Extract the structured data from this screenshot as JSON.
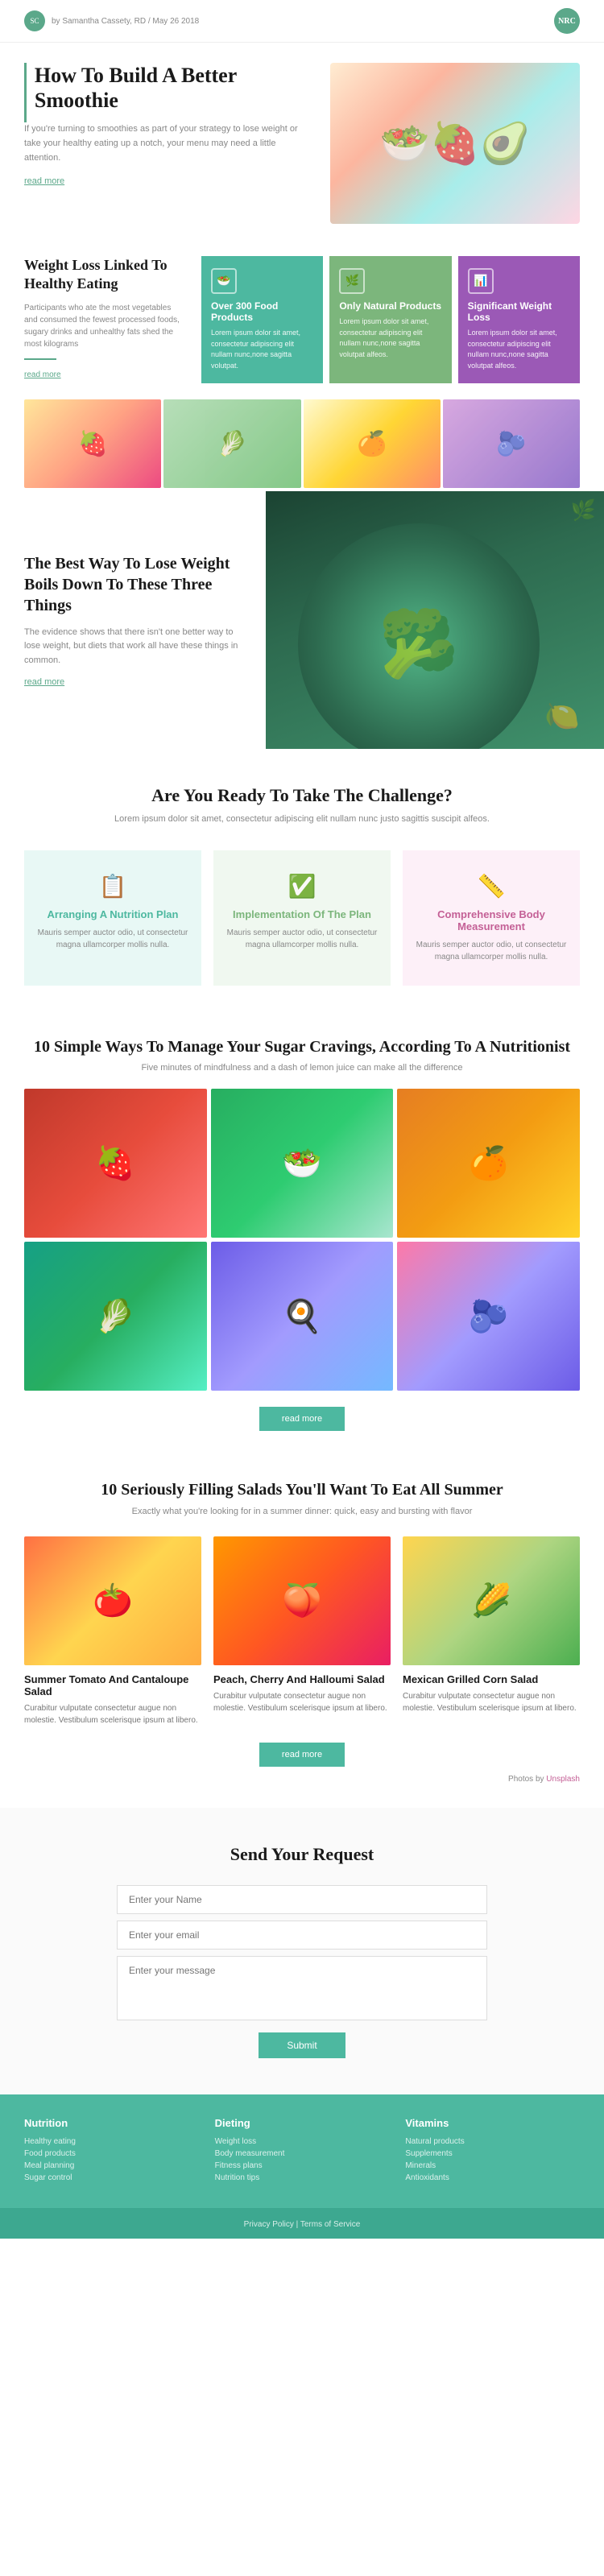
{
  "header": {
    "author": "by Samantha Cassety, RD / May 26 2018",
    "logo_text": "NRC"
  },
  "hero": {
    "title": "How To Build A Better Smoothie",
    "description": "If you're turning to smoothies as part of your strategy to lose weight or take your healthy eating up a notch, your menu may need a little attention.",
    "read_more": "read more"
  },
  "weight_section": {
    "title": "Weight Loss Linked To Healthy Eating",
    "description": "Participants who ate the most vegetables and consumed the fewest processed foods, sugary drinks and unhealthy fats shed the most kilograms",
    "read_more": "read more",
    "cards": [
      {
        "title": "Over 300 Food Products",
        "text": "Lorem ipsum dolor sit amet, consectetur adipiscing elit nullam nunc,none sagitta volutpat.",
        "bg": "teal",
        "icon": "🥗"
      },
      {
        "title": "Only Natural Products",
        "text": "Lorem ipsum dolor sit amet, consectetur adipiscing elit nullam nunc,none sagitta volutpat alfeos.",
        "bg": "green",
        "icon": "🌿"
      },
      {
        "title": "Significant Weight Loss",
        "text": "Lorem ipsum dolor sit amet, consectetur adipiscing elit nullam nunc,none sagitta volutpat alfeos.",
        "bg": "purple",
        "icon": "📊"
      }
    ]
  },
  "best_way": {
    "title": "The Best Way To Lose Weight Boils Down To These Three Things",
    "description": "The evidence shows that there isn't one better way to lose weight, but diets that work all have these things in common.",
    "read_more": "read more"
  },
  "challenge": {
    "title": "Are You Ready To Take The Challenge?",
    "subtitle": "Lorem ipsum dolor sit amet, consectetur adipiscing elit nullam nunc justo sagittis suscipit alfeos.",
    "cards": [
      {
        "title": "Arranging A Nutrition Plan",
        "text": "Mauris semper auctor odio, ut consectetur magna ullamcorper mollis nulla.",
        "bg": "teal",
        "icon": "📋"
      },
      {
        "title": "Implementation Of The Plan",
        "text": "Mauris semper auctor odio, ut consectetur magna ullamcorper mollis nulla.",
        "bg": "green",
        "icon": "✅"
      },
      {
        "title": "Comprehensive Body Measurement",
        "text": "Mauris semper auctor odio, ut consectetur magna ullamcorper mollis nulla.",
        "bg": "pink",
        "icon": "📏"
      }
    ]
  },
  "sugar": {
    "title": "10 Simple Ways To Manage Your Sugar Cravings, According To A Nutritionist",
    "subtitle": "Five minutes of mindfulness and a dash of lemon juice can make all the difference",
    "read_more": "read more"
  },
  "salads": {
    "title": "10 Seriously Filling Salads You'll Want To Eat All Summer",
    "subtitle": "Exactly what you're looking for in a summer dinner: quick, easy and bursting with flavor",
    "read_more": "read more",
    "photos_by": "Photos by",
    "photos_link": "Unsplash",
    "items": [
      {
        "name": "Summer Tomato And Cantaloupe Salad",
        "description": "Curabitur vulputate consectetur augue non molestie. Vestibulum scelerisque ipsum at libero."
      },
      {
        "name": "Peach, Cherry And Halloumi Salad",
        "description": "Curabitur vulputate consectetur augue non molestie. Vestibulum scelerisque ipsum at libero."
      },
      {
        "name": "Mexican Grilled Corn Salad",
        "description": "Curabitur vulputate consectetur augue non molestie. Vestibulum scelerisque ipsum at libero."
      }
    ]
  },
  "contact": {
    "title": "Send Your Request",
    "fields": {
      "name_placeholder": "Enter your Name",
      "email_placeholder": "Enter your email",
      "message_placeholder": "Enter your message"
    },
    "submit_label": "Submit"
  },
  "footer": {
    "columns": [
      {
        "title": "Nutrition",
        "links": [
          "Healthy eating",
          "Food products",
          "Meal planning",
          "Sugar control"
        ]
      },
      {
        "title": "Dieting",
        "links": [
          "Weight loss",
          "Body measurement",
          "Fitness plans",
          "Nutrition tips"
        ]
      },
      {
        "title": "Vitamins",
        "links": [
          "Natural products",
          "Supplements",
          "Minerals",
          "Antioxidants"
        ]
      }
    ],
    "bottom_text": "Privacy Policy  |  Terms of Service"
  }
}
